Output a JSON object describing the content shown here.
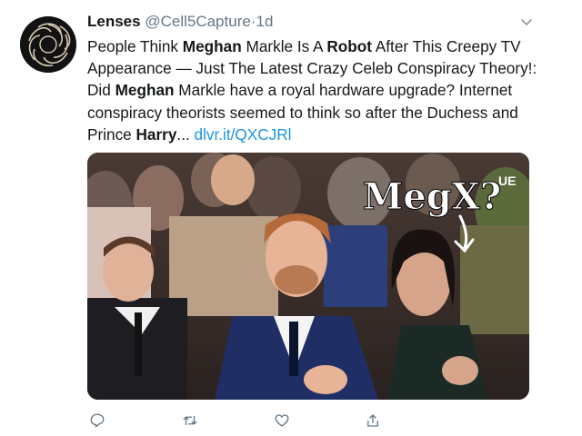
{
  "tweet": {
    "display_name": "Lenses",
    "handle": "@Cell5Capture",
    "separator": "·",
    "time": "1d",
    "text": {
      "t1": "People Think ",
      "b1": "Meghan",
      "t2": " Markle Is A ",
      "b2": "Robot",
      "t3": " After This Creepy TV Appearance — Just The Latest Crazy Celeb Conspiracy Theory!: Did ",
      "b3": "Meghan",
      "t4": " Markle have a royal hardware upgrade? Internet conspiracy theorists seemed to think so after the Duchess and Prince ",
      "b4": "Harry",
      "t5": "... ",
      "link": "dlvr.it/QXCJRl"
    },
    "media": {
      "overlay_text": "MegX?",
      "badge_text": "UE"
    }
  },
  "icons": {
    "avatar": "spiral-lens-logo",
    "more": "chevron-down-icon",
    "reply": "reply-icon",
    "retweet": "retweet-icon",
    "like": "like-icon",
    "share": "share-icon"
  },
  "colors": {
    "link": "#1b95e0",
    "secondary_text": "#657786",
    "icon": "#657786"
  }
}
